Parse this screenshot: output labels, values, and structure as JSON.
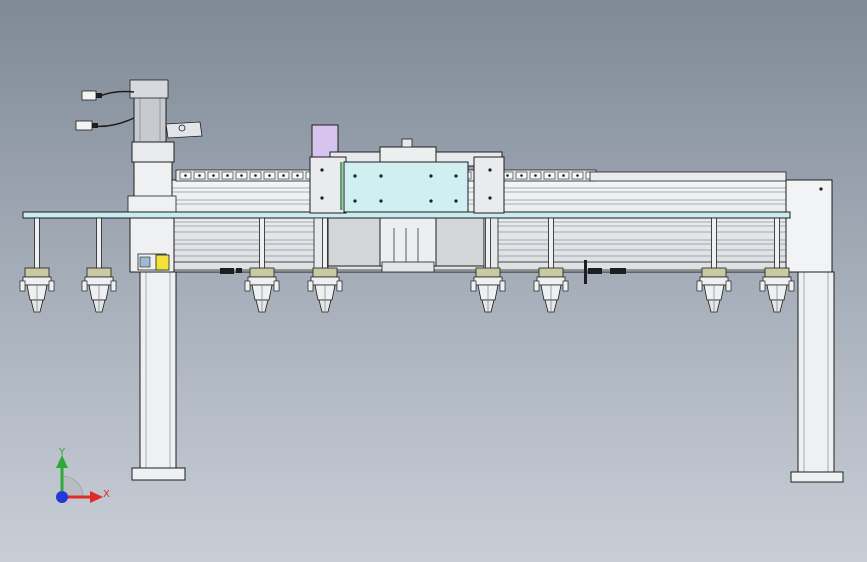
{
  "viewport": {
    "background_top": "#7f8a97",
    "background_bottom": "#c9ced6"
  },
  "model": {
    "line_color": "#1e1e1e",
    "body_fill": "#eef0f2",
    "plate_fill": "#c8ecef",
    "carriage_fill": "#cfeff1",
    "bracket_fill": "#c9c9a4",
    "purple_block": "#d6c4ee",
    "yellow_marker": "#f4e23a",
    "green_strip": "#5ea06a"
  },
  "nozzle_count": 10,
  "triad": {
    "y_label": "Y",
    "x_label": "X",
    "y_color": "#2fa93a",
    "x_color": "#e02a2a",
    "z_color": "#2438d8"
  }
}
